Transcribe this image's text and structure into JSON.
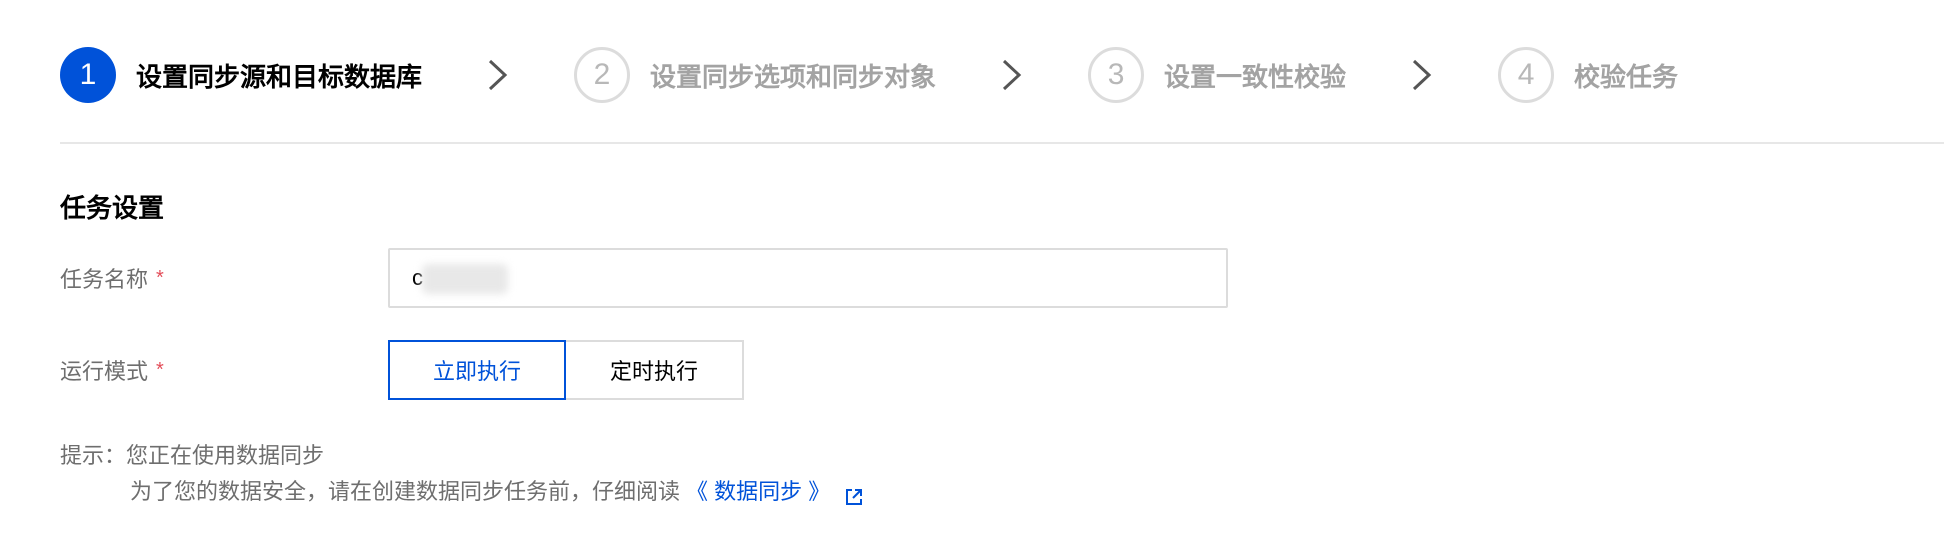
{
  "steps": [
    {
      "number": "1",
      "label": "设置同步源和目标数据库",
      "state": "active"
    },
    {
      "number": "2",
      "label": "设置同步选项和同步对象",
      "state": "inactive"
    },
    {
      "number": "3",
      "label": "设置一致性校验",
      "state": "inactive"
    },
    {
      "number": "4",
      "label": "校验任务",
      "state": "inactive"
    }
  ],
  "section": {
    "title": "任务设置"
  },
  "form": {
    "task_name": {
      "label": "任务名称",
      "required_mark": "*",
      "value": "c"
    },
    "run_mode": {
      "label": "运行模式",
      "required_mark": "*",
      "options": [
        "立即执行",
        "定时执行"
      ],
      "selected": "立即执行"
    }
  },
  "tip": {
    "prefix": "提示：",
    "line1": "您正在使用数据同步",
    "line2": "为了您的数据安全，请在创建数据同步任务前，仔细阅读",
    "link_text": "《 数据同步 》"
  },
  "icons": {
    "step_separator": "chevron-right-icon",
    "external_link": "external-link-icon"
  },
  "colors": {
    "primary": "#0052d9",
    "required": "#e34d59",
    "muted_text": "#6e6e6e",
    "inactive_step": "#a3a3a3",
    "border": "#dcdcdc"
  }
}
